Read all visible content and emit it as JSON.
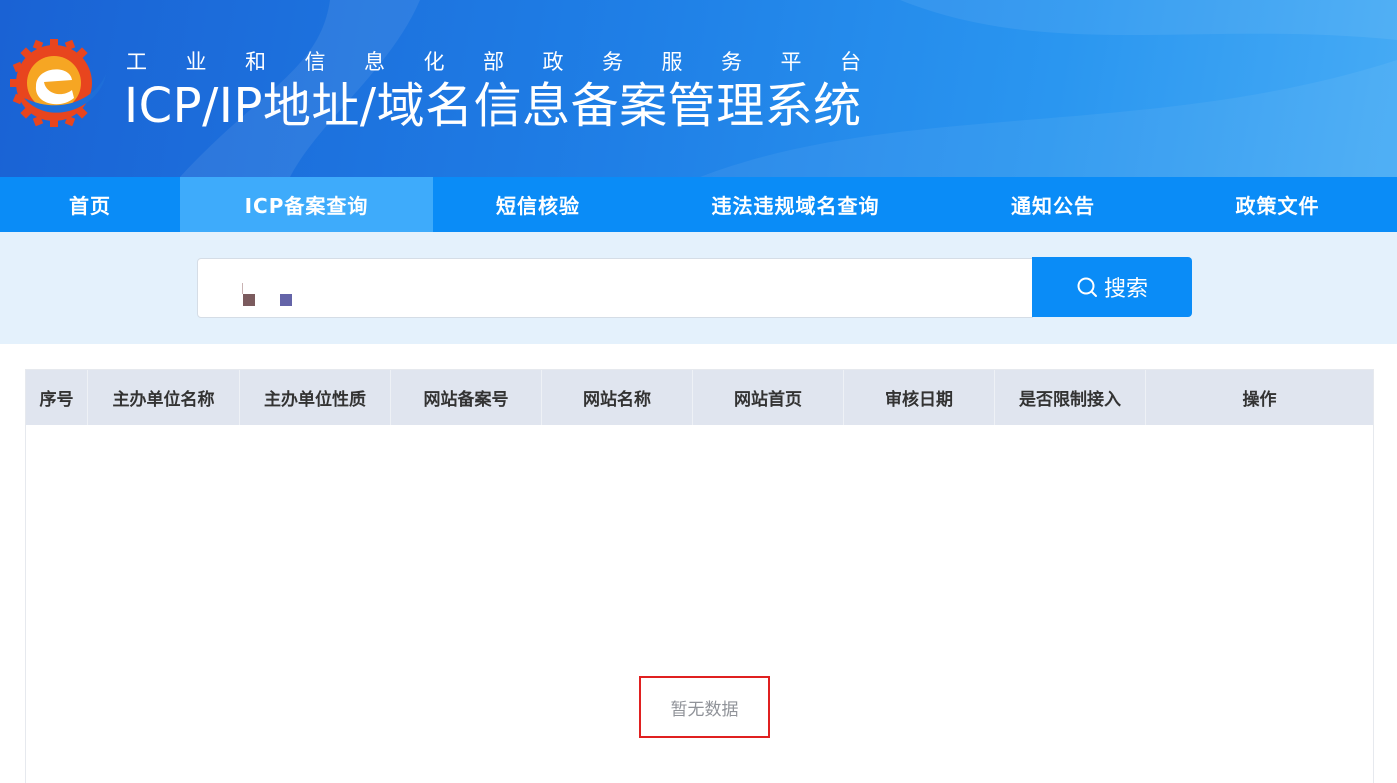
{
  "header": {
    "subtitle": "工业和信息化部政务服务平台",
    "title": "ICP/IP地址/域名信息备案管理系统"
  },
  "nav": {
    "items": [
      {
        "label": "首页",
        "active": false
      },
      {
        "label": "ICP备案查询",
        "active": true
      },
      {
        "label": "短信核验",
        "active": false
      },
      {
        "label": "违法违规域名查询",
        "active": false
      },
      {
        "label": "通知公告",
        "active": false
      },
      {
        "label": "政策文件",
        "active": false
      }
    ]
  },
  "search": {
    "value": "",
    "button_label": "搜索"
  },
  "table": {
    "columns": [
      "序号",
      "主办单位名称",
      "主办单位性质",
      "网站备案号",
      "网站名称",
      "网站首页",
      "审核日期",
      "是否限制接入",
      "操作"
    ],
    "rows": [],
    "empty_text": "暂无数据"
  },
  "colors": {
    "nav_bg": "#0a8cf7",
    "nav_active": "#3eabfb",
    "search_area_bg": "#e4f1fc",
    "table_header_bg": "#e0e5ef",
    "highlight_border": "#e02020"
  }
}
